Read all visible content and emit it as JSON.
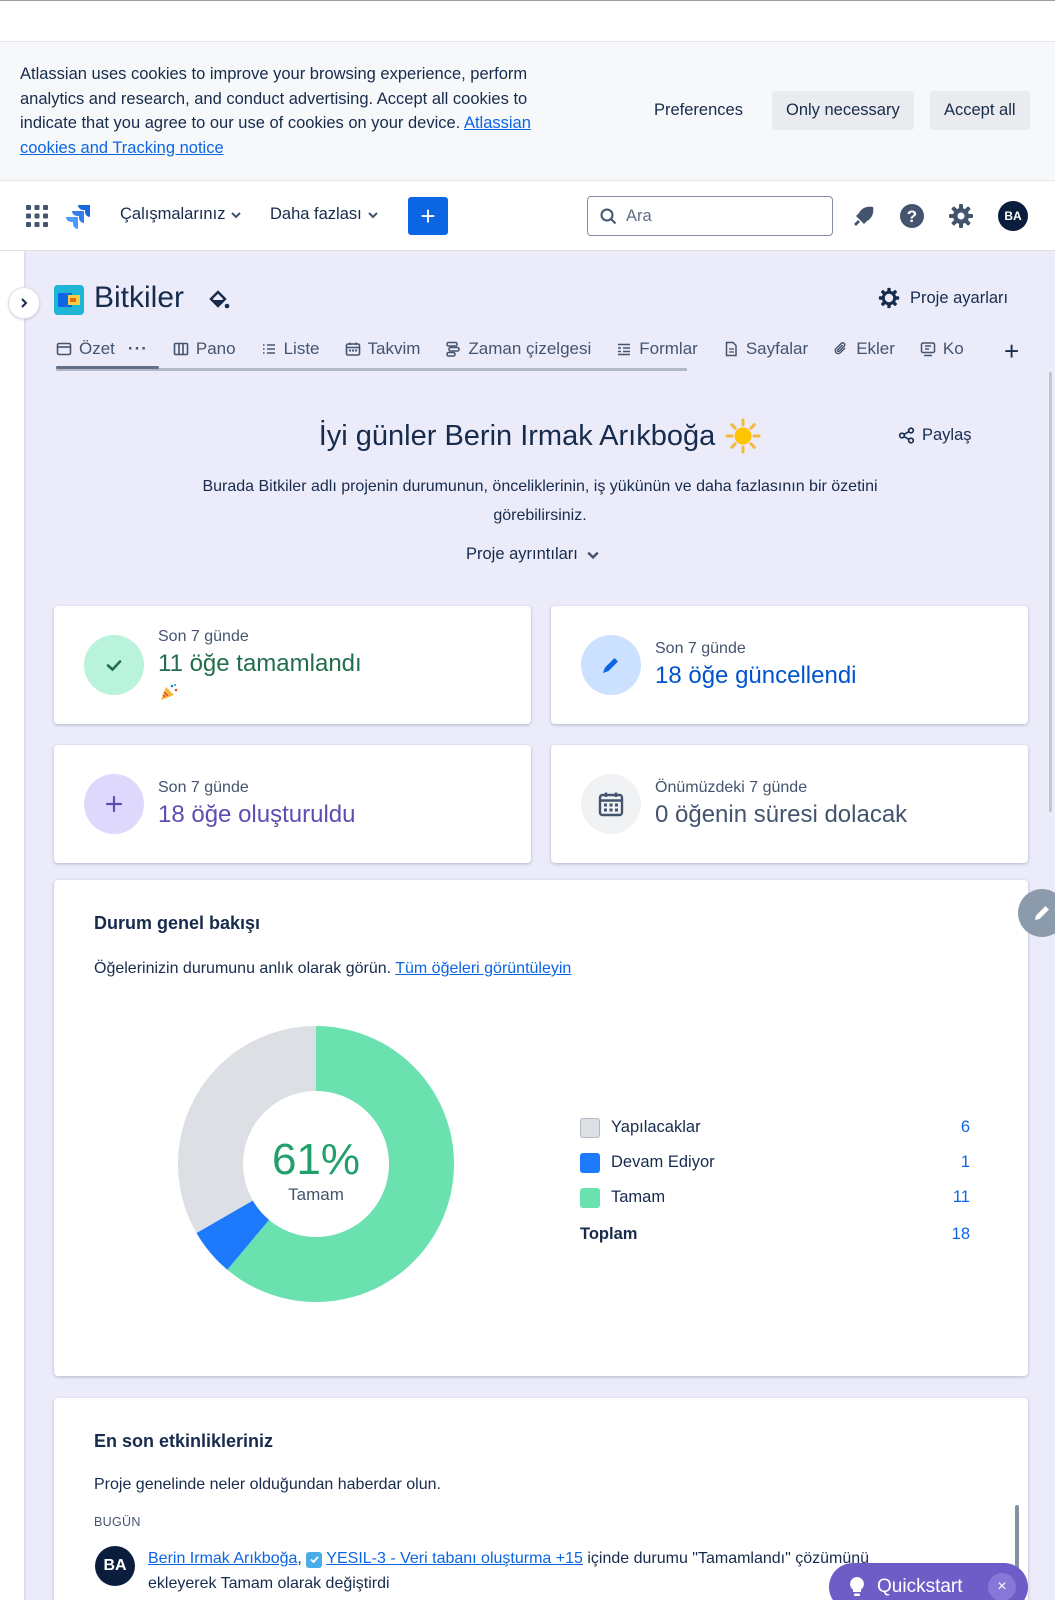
{
  "cookie_banner": {
    "text": "Atlassian uses cookies to improve your browsing experience, perform analytics and research, and conduct advertising. Accept all cookies to indicate that you agree to our use of cookies on your device. ",
    "link_text": "Atlassian cookies and Tracking notice",
    "preferences_label": "Preferences",
    "only_necessary_label": "Only necessary",
    "accept_all_label": "Accept all"
  },
  "topnav": {
    "works_label": "Çalışmalarınız",
    "more_label": "Daha fazlası",
    "create_label": "+",
    "search_placeholder": "Ara",
    "avatar_initials": "BA",
    "icons": [
      "app-switcher-icon",
      "jira-logo-icon",
      "notifications-icon",
      "help-icon",
      "settings-icon"
    ]
  },
  "project": {
    "name": "Bitkiler",
    "settings_label": "Proje ayarları"
  },
  "tabs": [
    {
      "label": "Özet",
      "icon": "summary-icon"
    },
    {
      "label": "Pano",
      "icon": "board-icon"
    },
    {
      "label": "Liste",
      "icon": "list-icon"
    },
    {
      "label": "Takvim",
      "icon": "calendar-icon"
    },
    {
      "label": "Zaman çizelgesi",
      "icon": "timeline-icon"
    },
    {
      "label": "Formlar",
      "icon": "forms-icon"
    },
    {
      "label": "Sayfalar",
      "icon": "pages-icon"
    },
    {
      "label": "Ekler",
      "icon": "attachments-icon"
    },
    {
      "label": "Ko",
      "icon": "code-icon"
    }
  ],
  "summary": {
    "greeting": "İyi günler Berin Irmak Arıkboğa",
    "share_label": "Paylaş",
    "intro": "Burada Bitkiler adlı projenin durumunun, önceliklerinin, iş yükünün ve daha fazlasının bir özetini görebilirsiniz.",
    "details_label": "Proje ayrıntıları"
  },
  "stats": [
    {
      "period": "Son 7 günde",
      "value": "11 öğe tamamlandı",
      "color": "#216e4e",
      "circle": "#baf3db"
    },
    {
      "period": "Son 7 günde",
      "value": "18 öğe güncellendi",
      "color": "#0055cc",
      "circle": "#cce0ff"
    },
    {
      "period": "Son 7 günde",
      "value": "18 öğe oluşturuldu",
      "color": "#5e4db2",
      "circle": "#dfd8fd"
    },
    {
      "period": "Önümüzdeki 7 günde",
      "value": "0 öğenin süresi dolacak",
      "color": "#44546f",
      "circle": "#f1f2f4"
    }
  ],
  "status_overview": {
    "title": "Durum genel bakışı",
    "description": "Öğelerinizin durumunu anlık olarak görün. ",
    "link": "Tüm öğeleri görüntüleyin",
    "total_label": "Toplam",
    "total_value": "18"
  },
  "chart_data": {
    "type": "pie",
    "center_value": "61%",
    "center_label": "Tamam",
    "categories": [
      "Yapılacaklar",
      "Devam Ediyor",
      "Tamam"
    ],
    "values": [
      6,
      1,
      11
    ],
    "colors": [
      "#dcdfe4",
      "#1d7afc",
      "#6be1b0"
    ]
  },
  "activity": {
    "title": "En son etkinlikleriniz",
    "description": "Proje genelinde neler olduğundan haberdar olun.",
    "day": "BUGÜN",
    "avatar_initials": "BA",
    "user": "Berin Irmak Arıkboğa",
    "separator": ", ",
    "item": "YESIL-3 - Veri tabanı oluşturma +15",
    "action": " içinde durumu \"Tamamlandı\" çözümünü ekleyerek Tamam olarak değiştirdi"
  },
  "quickstart": {
    "label": "Quickstart",
    "close_label": "×"
  }
}
